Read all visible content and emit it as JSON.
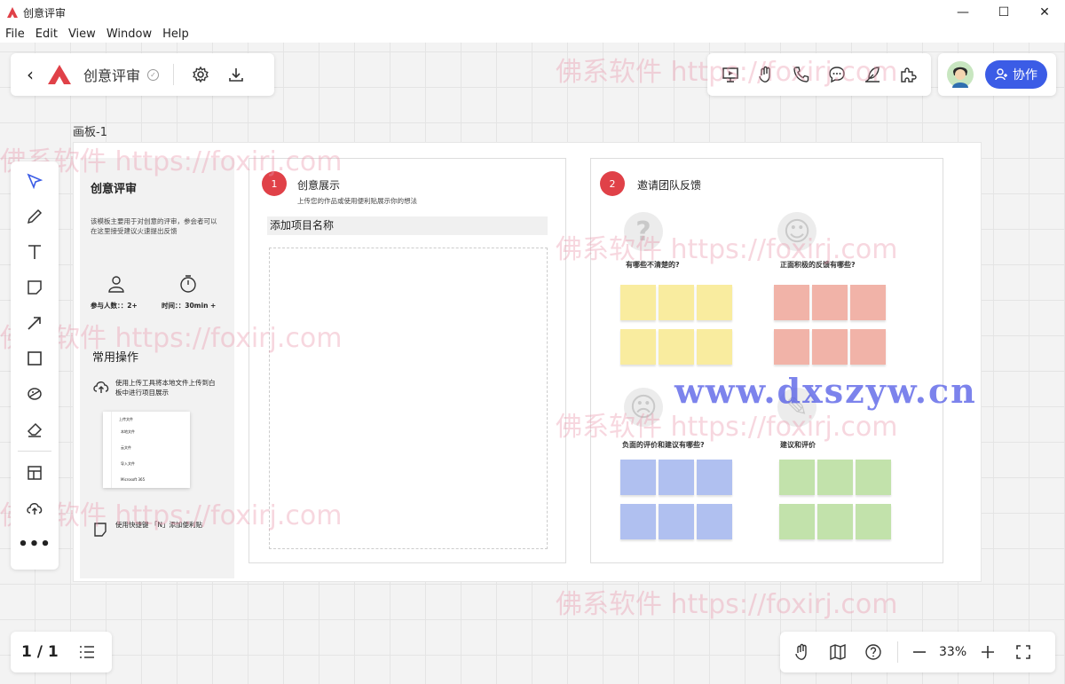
{
  "window": {
    "title": "创意评审"
  },
  "menu": [
    "File",
    "Edit",
    "View",
    "Window",
    "Help"
  ],
  "header": {
    "doc_title": "创意评审"
  },
  "collab": {
    "label": "协作"
  },
  "board": {
    "name": "画板-1"
  },
  "template": {
    "title": "创意评审",
    "desc": "该模板主要用于对创意的评审，参会者可以在这里接受建议火速提出反馈",
    "participants": "参与人数：：2+",
    "time": "时间：：30min +",
    "ops_title": "常用操作",
    "op1": "使用上传工具将本地文件上传到白板中进行项目展示",
    "op2": "使用快捷键 「N」添加便利贴",
    "mini_title": "上传文件",
    "mini_items": [
      "本地文件",
      "云文件",
      "导入文件",
      "Microsoft 365"
    ]
  },
  "section1": {
    "num": "1",
    "title": "创意展示",
    "subtitle": "上传您的作品或使用便利贴展示你的想法",
    "input_label": "添加项目名称"
  },
  "section2": {
    "num": "2",
    "title": "邀请团队反馈",
    "q1": "有哪些不清楚的?",
    "q2": "正面积极的反馈有哪些?",
    "q3": "负面的评价和建议有哪些?",
    "q4": "建议和评价",
    "colors": {
      "yellow": "#f9ec9f",
      "red": "#f1b3a8",
      "blue": "#b0c0f0",
      "green": "#c2e2ab"
    }
  },
  "footer": {
    "page": "1 / 1",
    "zoom": "33%"
  },
  "watermarks": {
    "a": "佛系软件 https://foxirj.com",
    "b": "www.dxszyw.cn"
  },
  "colors": {
    "accent": "#e04148",
    "collab": "#3b5ce6"
  }
}
